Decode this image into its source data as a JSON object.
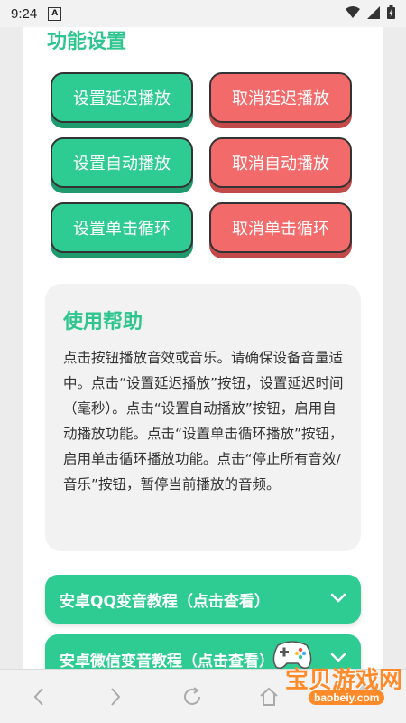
{
  "status_bar": {
    "time": "9:24",
    "a_label": "A"
  },
  "settings": {
    "title": "功能设置",
    "buttons": [
      {
        "label": "设置延迟播放",
        "style": "green"
      },
      {
        "label": "取消延迟播放",
        "style": "red"
      },
      {
        "label": "设置自动播放",
        "style": "green"
      },
      {
        "label": "取消自动播放",
        "style": "red"
      },
      {
        "label": "设置单击循环",
        "style": "green"
      },
      {
        "label": "取消单击循环",
        "style": "red"
      }
    ]
  },
  "help": {
    "title": "使用帮助",
    "body": "点击按钮播放音效或音乐。请确保设备音量适中。点击“设置延迟播放”按钮，设置延迟时间（毫秒）。点击“设置自动播放”按钮，启用自动播放功能。点击“设置单击循环播放”按钮，启用单击循环播放功能。点击“停止所有音效/音乐”按钮，暂停当前播放的音频。"
  },
  "accordions": [
    {
      "label": "安卓QQ变音教程（点击查看）"
    },
    {
      "label": "安卓微信变音教程（点击查看）"
    }
  ],
  "watermark": {
    "brand": "宝贝游戏网",
    "url": "baobeiy.com"
  },
  "colors": {
    "accent_green": "#2ecc93",
    "accent_red": "#f26a6a",
    "title_green": "#2fc58f"
  }
}
